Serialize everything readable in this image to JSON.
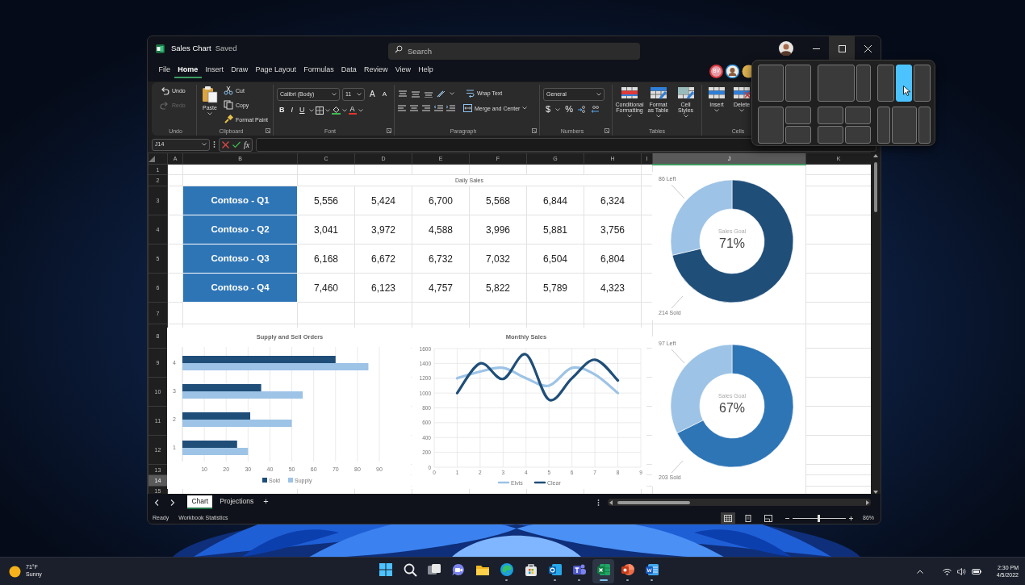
{
  "window": {
    "title": "Sales Chart",
    "save_status": "Saved",
    "search": {
      "placeholder": "Search"
    }
  },
  "menu_tabs": [
    {
      "label": "File",
      "selected": false
    },
    {
      "label": "Home",
      "selected": true
    },
    {
      "label": "Insert",
      "selected": false
    },
    {
      "label": "Draw",
      "selected": false
    },
    {
      "label": "Page Layout",
      "selected": false
    },
    {
      "label": "Formulas",
      "selected": false
    },
    {
      "label": "Data",
      "selected": false
    },
    {
      "label": "Review",
      "selected": false
    },
    {
      "label": "View",
      "selected": false
    },
    {
      "label": "Help",
      "selected": false
    }
  ],
  "collaborators": [
    {
      "initials": "BV"
    }
  ],
  "ribbon": {
    "groups": [
      {
        "kind": "undo",
        "label": "Undo",
        "commands": [
          {
            "label": "Undo",
            "disabled": false
          },
          {
            "label": "Redo",
            "disabled": true
          }
        ]
      },
      {
        "kind": "clipboard",
        "label": "Clipboard",
        "commands": [
          {
            "label": "Paste"
          },
          {
            "label": "Cut"
          },
          {
            "label": "Copy"
          },
          {
            "label": "Format Paint"
          }
        ]
      },
      {
        "kind": "font",
        "label": "Font",
        "font_name": "Calibri (Body)",
        "font_size": "11",
        "grow": "A",
        "shrink": "A",
        "styles": [
          "B",
          "I",
          "U"
        ],
        "font_color": "A"
      },
      {
        "kind": "paragraph",
        "label": "Paragraph",
        "commands": [
          {
            "label": "Wrap Text"
          },
          {
            "label": "Merge and Center"
          }
        ]
      },
      {
        "kind": "numbers",
        "label": "Numbers",
        "format": "General",
        "symbols": [
          "$",
          "%"
        ]
      },
      {
        "kind": "tables",
        "label": "Tables",
        "commands": [
          {
            "label": "Conditional Formatting"
          },
          {
            "label": "Format as Table"
          },
          {
            "label": "Cell Styles"
          }
        ]
      },
      {
        "kind": "cells",
        "label": "Cells",
        "commands": [
          {
            "label": "Insert"
          },
          {
            "label": "Delete"
          }
        ]
      }
    ]
  },
  "formula_bar": {
    "name_box": "J14",
    "fx": "fx"
  },
  "sheet": {
    "columns": [
      {
        "label": "A",
        "selected": false
      },
      {
        "label": "B",
        "selected": false
      },
      {
        "label": "C",
        "selected": false
      },
      {
        "label": "D",
        "selected": false
      },
      {
        "label": "E",
        "selected": false
      },
      {
        "label": "F",
        "selected": false
      },
      {
        "label": "G",
        "selected": false
      },
      {
        "label": "H",
        "selected": false
      },
      {
        "label": "I",
        "selected": false
      },
      {
        "label": "J",
        "selected": true
      },
      {
        "label": "K",
        "selected": false
      }
    ],
    "rows": [
      {
        "number": "1",
        "selected": false
      },
      {
        "number": "2",
        "selected": false
      },
      {
        "number": "3",
        "selected": false
      },
      {
        "number": "4",
        "selected": false
      },
      {
        "number": "5",
        "selected": false
      },
      {
        "number": "6",
        "selected": false
      },
      {
        "number": "7",
        "selected": false
      },
      {
        "number": "8",
        "selected": false
      },
      {
        "number": "9",
        "selected": false
      },
      {
        "number": "10",
        "selected": false
      },
      {
        "number": "11",
        "selected": false
      },
      {
        "number": "12",
        "selected": false
      },
      {
        "number": "13",
        "selected": false
      },
      {
        "number": "14",
        "selected": true
      },
      {
        "number": "15",
        "selected": false
      }
    ],
    "table": {
      "title": "Daily Sales",
      "rows": [
        {
          "label": "Contoso - Q1",
          "values": [
            "5,556",
            "5,424",
            "6,700",
            "5,568",
            "6,844",
            "6,324"
          ]
        },
        {
          "label": "Contoso - Q2",
          "values": [
            "3,041",
            "3,972",
            "4,588",
            "3,996",
            "5,881",
            "3,756"
          ]
        },
        {
          "label": "Contoso - Q3",
          "values": [
            "6,168",
            "6,672",
            "6,732",
            "7,032",
            "6,504",
            "6,804"
          ]
        },
        {
          "label": "Contoso - Q4",
          "values": [
            "7,460",
            "6,123",
            "4,757",
            "5,822",
            "5,789",
            "4,323"
          ]
        }
      ]
    },
    "charts": [
      {
        "chart_data": {
          "type": "bar",
          "orientation": "horizontal",
          "title": "Supply and Sell Orders",
          "categories": [
            "4",
            "3",
            "2",
            "1"
          ],
          "series": [
            {
              "name": "Sold",
              "color": "#1f4e79",
              "values": [
                70,
                36,
                31,
                25
              ]
            },
            {
              "name": "Supply",
              "color": "#9dc3e6",
              "values": [
                85,
                55,
                50,
                30
              ]
            }
          ],
          "xticks": [
            10,
            20,
            30,
            40,
            50,
            60,
            70,
            80,
            90
          ],
          "xlim": [
            0,
            90
          ],
          "grid": true,
          "legend": "bottom"
        }
      },
      {
        "chart_data": {
          "type": "line",
          "title": "Monthly Sales",
          "x": [
            1,
            2,
            3,
            4,
            5,
            6,
            7,
            8
          ],
          "series": [
            {
              "name": "Elvis",
              "color": "#9dc3e6",
              "values": [
                1200,
                1290,
                1340,
                1200,
                1100,
                1340,
                1250,
                1000
              ]
            },
            {
              "name": "Clear",
              "color": "#1f4e79",
              "values": [
                1000,
                1400,
                1190,
                1520,
                910,
                1200,
                1450,
                1170
              ]
            }
          ],
          "xticks": [
            0,
            1,
            2,
            3,
            4,
            5,
            6,
            7,
            8,
            9
          ],
          "yticks": [
            0,
            200,
            400,
            600,
            800,
            1000,
            1200,
            1400,
            1600
          ],
          "xlim": [
            0,
            9
          ],
          "ylim": [
            0,
            1600
          ],
          "grid": true,
          "legend": "bottom"
        }
      },
      {
        "chart_data": {
          "type": "donut",
          "categories": [
            "214 Sold",
            "86 Left"
          ],
          "series": [
            {
              "name": "Sales Goal",
              "values": [
                214,
                86
              ]
            }
          ],
          "colors": [
            "#1f4e79",
            "#9dc3e6"
          ],
          "annotations": [
            {
              "text": "71%"
            }
          ]
        }
      },
      {
        "chart_data": {
          "type": "donut",
          "categories": [
            "203 Sold",
            "97 Left"
          ],
          "series": [
            {
              "name": "Sales Goal",
              "values": [
                203,
                97
              ]
            }
          ],
          "colors": [
            "#2e75b6",
            "#9dc3e6"
          ],
          "annotations": [
            {
              "text": "67%"
            }
          ]
        }
      }
    ]
  },
  "sheet_tabs": [
    {
      "label": "Chart",
      "selected": true
    },
    {
      "label": "Projections",
      "selected": false
    }
  ],
  "add_sheet": "+",
  "status_bar": {
    "mode": "Ready",
    "statistics": "Workbook Statistics",
    "views": [
      {
        "selected": true
      },
      {
        "selected": false
      },
      {
        "selected": false
      }
    ],
    "zoom": {
      "level": 0.49,
      "reading": "86%"
    }
  },
  "snap_layouts": [
    {
      "kind": "halves",
      "zones": [
        {
          "selected": false
        },
        {
          "selected": false
        }
      ]
    },
    {
      "kind": "two-thirds-left",
      "zones": [
        {
          "selected": false
        },
        {
          "selected": false
        }
      ]
    },
    {
      "kind": "thirds",
      "zones": [
        {
          "selected": false
        },
        {
          "selected": true
        },
        {
          "selected": false
        }
      ]
    },
    {
      "kind": "main-stack",
      "zones": [
        {
          "selected": false
        },
        {
          "selected": false
        },
        {
          "selected": false
        }
      ]
    },
    {
      "kind": "quad",
      "zones": [
        {
          "selected": false
        },
        {
          "selected": false
        },
        {
          "selected": false
        },
        {
          "selected": false
        }
      ]
    },
    {
      "kind": "wide-center",
      "zones": [
        {
          "selected": false
        },
        {
          "selected": false
        },
        {
          "selected": false
        }
      ]
    }
  ],
  "taskbar": {
    "weather": {
      "temperature": "71°F",
      "condition": "Sunny"
    },
    "apps": [
      {
        "kind": "start",
        "running": false,
        "selected": false
      },
      {
        "kind": "search",
        "running": false,
        "selected": false
      },
      {
        "kind": "taskview",
        "running": false,
        "selected": false
      },
      {
        "kind": "chat",
        "running": false,
        "selected": false
      },
      {
        "kind": "folder",
        "running": false,
        "selected": false
      },
      {
        "kind": "browser",
        "running": true,
        "selected": false
      },
      {
        "kind": "store",
        "running": false,
        "selected": false
      },
      {
        "kind": "mail",
        "running": true,
        "selected": false
      },
      {
        "kind": "people",
        "running": true,
        "selected": false
      },
      {
        "kind": "sheet",
        "running": true,
        "selected": true
      },
      {
        "kind": "slides",
        "running": true,
        "selected": false
      },
      {
        "kind": "doc",
        "running": true,
        "selected": false
      }
    ],
    "clock": {
      "time": "2:30 PM",
      "date": "4/5/2022"
    }
  }
}
